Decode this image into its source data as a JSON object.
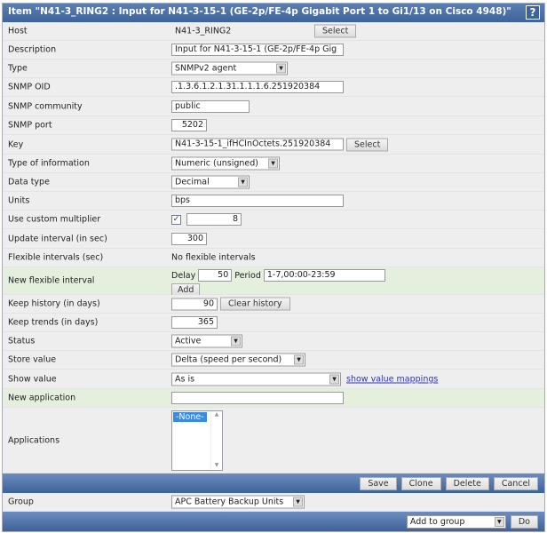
{
  "title": "Item \"N41-3_RING2 : Input for N41-3-15-1 (GE-2p/FE-4p Gigabit Port 1 to Gi1/13 on Cisco 4948)\"",
  "help": "?",
  "fields": {
    "host": {
      "label": "Host",
      "value": "N41-3_RING2",
      "button": "Select"
    },
    "description": {
      "label": "Description",
      "value": "Input for N41-3-15-1 (GE-2p/FE-4p Gig"
    },
    "type": {
      "label": "Type",
      "value": "SNMPv2 agent"
    },
    "snmp_oid": {
      "label": "SNMP OID",
      "value": ".1.3.6.1.2.1.31.1.1.1.6.251920384"
    },
    "snmp_community": {
      "label": "SNMP community",
      "value": "public"
    },
    "snmp_port": {
      "label": "SNMP port",
      "value": "5202"
    },
    "key": {
      "label": "Key",
      "value": "N41-3-15-1_ifHCInOctets.251920384",
      "button": "Select"
    },
    "type_of_information": {
      "label": "Type of information",
      "value": "Numeric (unsigned)"
    },
    "data_type": {
      "label": "Data type",
      "value": "Decimal"
    },
    "units": {
      "label": "Units",
      "value": "bps"
    },
    "custom_multiplier": {
      "label": "Use custom multiplier",
      "checked": true,
      "value": "8"
    },
    "update_interval": {
      "label": "Update interval (in sec)",
      "value": "300"
    },
    "flexible_intervals": {
      "label": "Flexible intervals (sec)",
      "value": "No flexible intervals"
    },
    "new_flexible_interval": {
      "label": "New flexible interval",
      "delay_label": "Delay",
      "delay": "50",
      "period_label": "Period",
      "period": "1-7,00:00-23:59",
      "button": "Add"
    },
    "keep_history": {
      "label": "Keep history (in days)",
      "value": "90",
      "button": "Clear history"
    },
    "keep_trends": {
      "label": "Keep trends (in days)",
      "value": "365"
    },
    "status": {
      "label": "Status",
      "value": "Active"
    },
    "store_value": {
      "label": "Store value",
      "value": "Delta (speed per second)"
    },
    "show_value": {
      "label": "Show value",
      "value": "As is",
      "link": "show value mappings"
    },
    "new_application": {
      "label": "New application",
      "value": ""
    },
    "applications": {
      "label": "Applications",
      "options": [
        "-None-"
      ]
    }
  },
  "actions": {
    "save": "Save",
    "clone": "Clone",
    "delete": "Delete",
    "cancel": "Cancel"
  },
  "group": {
    "label": "Group",
    "value": "APC Battery Backup Units"
  },
  "footer": {
    "action": "Add to group",
    "do": "Do"
  }
}
